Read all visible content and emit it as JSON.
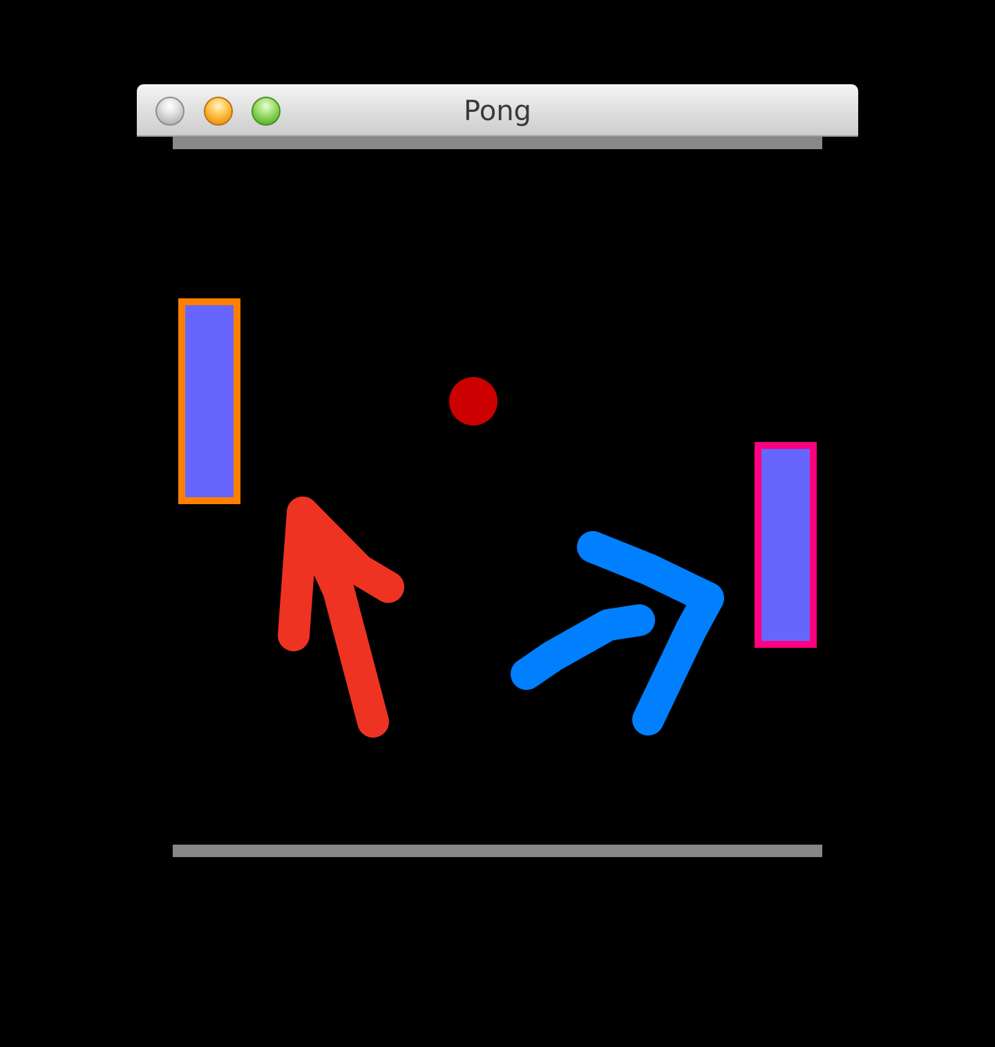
{
  "window": {
    "title": "Pong",
    "buttons": [
      "close-button",
      "minimize-button",
      "zoom-button"
    ]
  },
  "game": {
    "background": "#000000",
    "wall_color": "#888888",
    "ball_color": "#cc0000",
    "paddles": {
      "left": {
        "fill": "#6666ff",
        "border": "#ff7f00"
      },
      "right": {
        "fill": "#6666ff",
        "border": "#ff0080"
      }
    }
  },
  "annotations": {
    "left_arrow_color": "#ee3322",
    "right_arrow_color": "#0080ff"
  }
}
